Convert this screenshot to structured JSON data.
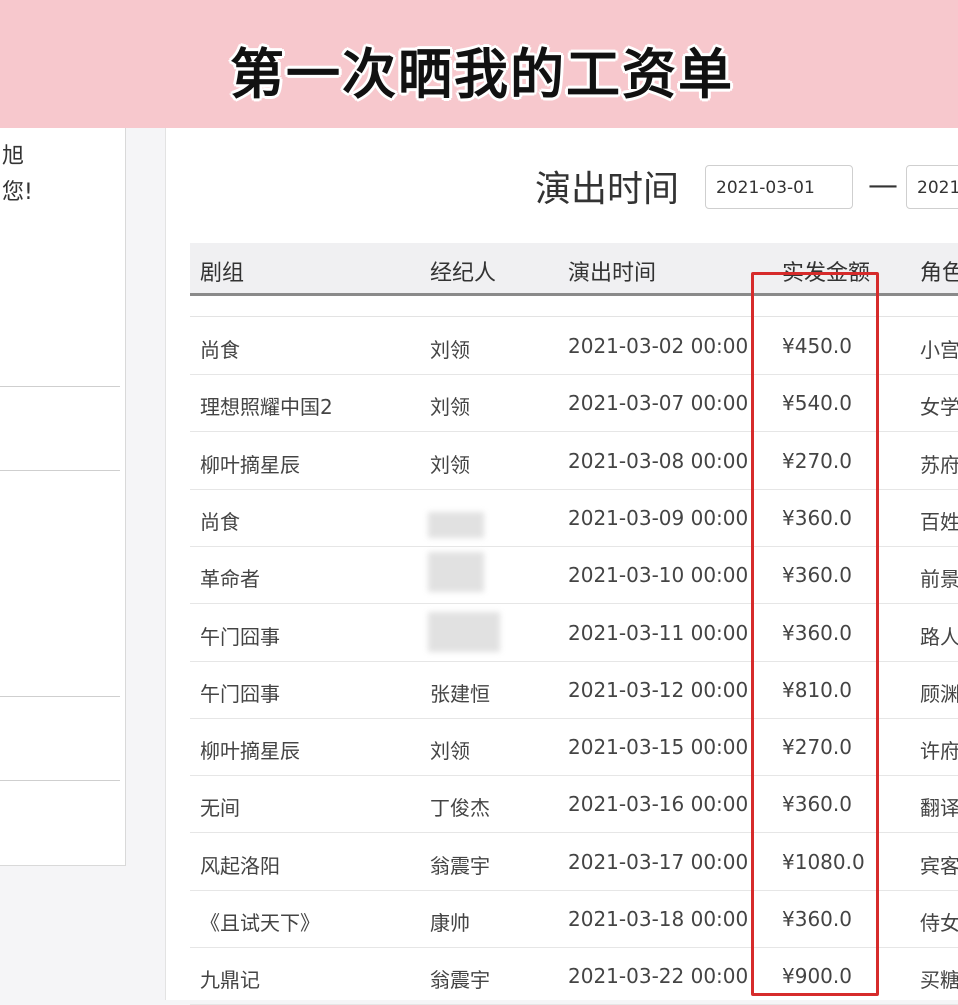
{
  "banner": {
    "title": "第一次晒我的工资单"
  },
  "sidebar": {
    "line1": "旭",
    "line2": "您!"
  },
  "filter": {
    "label": "演出时间",
    "start_date": "2021-03-01",
    "separator": "—",
    "end_date": "2021"
  },
  "table": {
    "headers": [
      "剧组",
      "经纪人",
      "演出时间",
      "实发金额",
      "角色"
    ],
    "rows": [
      {
        "crew": "尚食",
        "agent": "刘领",
        "time": "2021-03-02 00:00",
        "amount": "¥450.0",
        "role": "小宫"
      },
      {
        "crew": "理想照耀中国2",
        "agent": "刘领",
        "time": "2021-03-07 00:00",
        "amount": "¥540.0",
        "role": "女学"
      },
      {
        "crew": "柳叶摘星辰",
        "agent": "刘领",
        "time": "2021-03-08 00:00",
        "amount": "¥270.0",
        "role": "苏府"
      },
      {
        "crew": "尚食",
        "agent": "",
        "time": "2021-03-09 00:00",
        "amount": "¥360.0",
        "role": "百姓"
      },
      {
        "crew": "革命者",
        "agent": "",
        "time": "2021-03-10 00:00",
        "amount": "¥360.0",
        "role": "前景"
      },
      {
        "crew": "午门囧事",
        "agent": "",
        "time": "2021-03-11 00:00",
        "amount": "¥360.0",
        "role": "路人"
      },
      {
        "crew": "午门囧事",
        "agent": "张建恒",
        "time": "2021-03-12 00:00",
        "amount": "¥810.0",
        "role": "顾渊"
      },
      {
        "crew": "柳叶摘星辰",
        "agent": "刘领",
        "time": "2021-03-15 00:00",
        "amount": "¥270.0",
        "role": "许府"
      },
      {
        "crew": "无间",
        "agent": "丁俊杰",
        "time": "2021-03-16 00:00",
        "amount": "¥360.0",
        "role": "翻译"
      },
      {
        "crew": "风起洛阳",
        "agent": "翁震宇",
        "time": "2021-03-17 00:00",
        "amount": "¥1080.0",
        "role": "宾客"
      },
      {
        "crew": "《且试天下》",
        "agent": "康帅",
        "time": "2021-03-18 00:00",
        "amount": "¥360.0",
        "role": "侍女"
      },
      {
        "crew": "九鼎记",
        "agent": "翁震宇",
        "time": "2021-03-22 00:00",
        "amount": "¥900.0",
        "role": "买糖"
      }
    ]
  },
  "colors": {
    "banner_bg": "#f7c8cd",
    "highlight_border": "#d62b2b"
  }
}
